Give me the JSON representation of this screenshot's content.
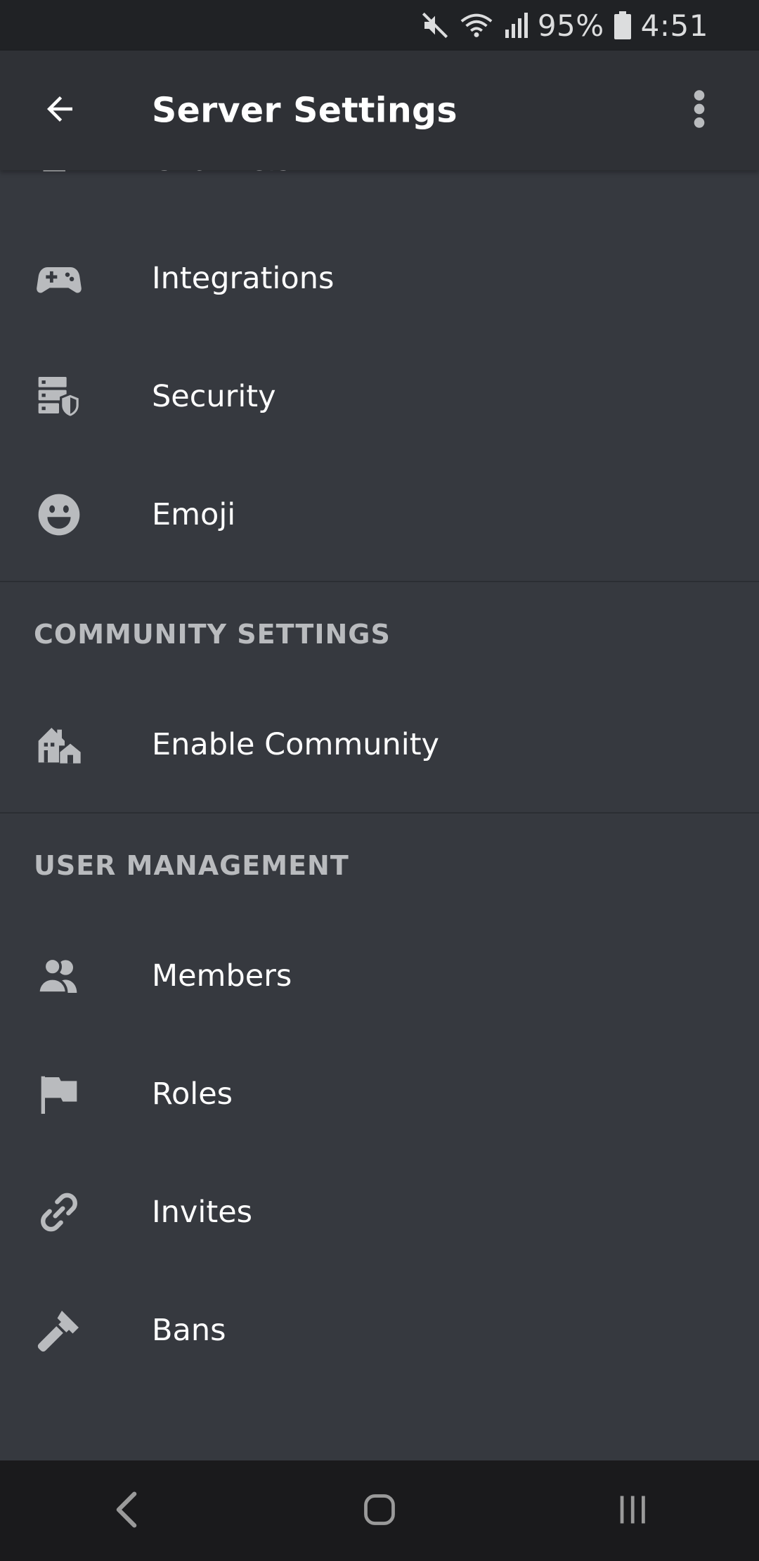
{
  "status_bar": {
    "battery": "95%",
    "time": "4:51"
  },
  "app_bar": {
    "title": "Server Settings",
    "back_icon": "arrow-left-icon",
    "overflow_icon": "more-vertical-icon"
  },
  "menu": {
    "top_items": [
      {
        "label": "Channels",
        "icon": "channels-icon"
      },
      {
        "label": "Integrations",
        "icon": "gamepad-icon"
      },
      {
        "label": "Security",
        "icon": "server-shield-icon"
      },
      {
        "label": "Emoji",
        "icon": "emoji-icon"
      }
    ],
    "community": {
      "header": "COMMUNITY SETTINGS",
      "items": [
        {
          "label": "Enable Community",
          "icon": "community-icon"
        }
      ]
    },
    "user_management": {
      "header": "USER MANAGEMENT",
      "items": [
        {
          "label": "Members",
          "icon": "members-icon"
        },
        {
          "label": "Roles",
          "icon": "flag-icon"
        },
        {
          "label": "Invites",
          "icon": "link-icon"
        },
        {
          "label": "Bans",
          "icon": "hammer-icon"
        }
      ]
    }
  },
  "colors": {
    "background": "#36393f",
    "app_bar": "#2f3136",
    "status_bar": "#202225",
    "text_primary": "#ffffff",
    "text_header": "#b9bbbe",
    "icon": "#b9bbbe"
  }
}
